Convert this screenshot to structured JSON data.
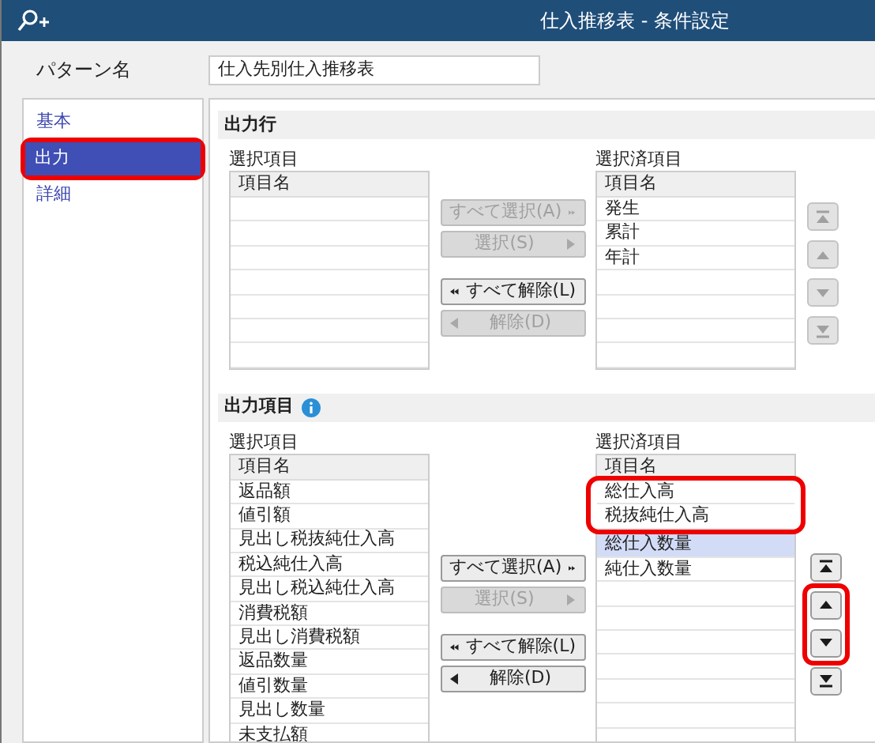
{
  "window": {
    "title": "仕入推移表 - 条件設定"
  },
  "pattern": {
    "label": "パターン名",
    "value": "仕入先別仕入推移表"
  },
  "sidebar": {
    "items": [
      {
        "label": "基本",
        "selected": false,
        "highlighted": false
      },
      {
        "label": "出力",
        "selected": true,
        "highlighted": true
      },
      {
        "label": "詳細",
        "selected": false,
        "highlighted": false
      }
    ]
  },
  "sections": [
    {
      "title": "出力行",
      "info": false,
      "available": {
        "label": "選択項目",
        "header": "項目名"
      },
      "chosen": {
        "label": "選択済項目",
        "header": "項目名",
        "rows": [
          {
            "text": "発生",
            "selected": false,
            "highlighted": false
          },
          {
            "text": "累計",
            "selected": false,
            "highlighted": false
          },
          {
            "text": "年計",
            "selected": false,
            "highlighted": false
          }
        ]
      },
      "transfer_buttons": [
        {
          "label": "すべて選択(A)",
          "kind": "add_all",
          "disabled": true
        },
        {
          "label": "選択(S)",
          "kind": "add",
          "disabled": true
        },
        {
          "label": "すべて解除(L)",
          "kind": "remove_all",
          "disabled": false
        },
        {
          "label": "解除(D)",
          "kind": "remove",
          "disabled": true
        }
      ],
      "move_buttons": [
        {
          "kind": "top",
          "disabled": true,
          "highlighted": false
        },
        {
          "kind": "up",
          "disabled": true,
          "highlighted": false
        },
        {
          "kind": "down",
          "disabled": true,
          "highlighted": false
        },
        {
          "kind": "bottom",
          "disabled": true,
          "highlighted": false
        }
      ]
    },
    {
      "title": "出力項目",
      "info": true,
      "available": {
        "label": "選択項目",
        "header": "項目名",
        "rows": [
          "返品額",
          "値引額",
          "見出し税抜純仕入高",
          "税込純仕入高",
          "見出し税込純仕入高",
          "消費税額",
          "見出し消費税額",
          "返品数量",
          "値引数量",
          "見出し数量",
          "未支払額"
        ]
      },
      "chosen": {
        "label": "選択済項目",
        "header": "項目名",
        "rows": [
          {
            "text": "総仕入高",
            "selected": false,
            "highlighted": true
          },
          {
            "text": "税抜純仕入高",
            "selected": false,
            "highlighted": true
          },
          {
            "text": "総仕入数量",
            "selected": true,
            "highlighted": false
          },
          {
            "text": "純仕入数量",
            "selected": false,
            "highlighted": false
          }
        ]
      },
      "transfer_buttons": [
        {
          "label": "すべて選択(A)",
          "kind": "add_all",
          "disabled": false
        },
        {
          "label": "選択(S)",
          "kind": "add",
          "disabled": true
        },
        {
          "label": "すべて解除(L)",
          "kind": "remove_all",
          "disabled": false
        },
        {
          "label": "解除(D)",
          "kind": "remove",
          "disabled": false
        }
      ],
      "move_buttons": [
        {
          "kind": "top",
          "disabled": false,
          "highlighted": false
        },
        {
          "kind": "up",
          "disabled": false,
          "highlighted": true
        },
        {
          "kind": "down",
          "disabled": false,
          "highlighted": true
        },
        {
          "kind": "bottom",
          "disabled": false,
          "highlighted": false
        }
      ]
    }
  ]
}
